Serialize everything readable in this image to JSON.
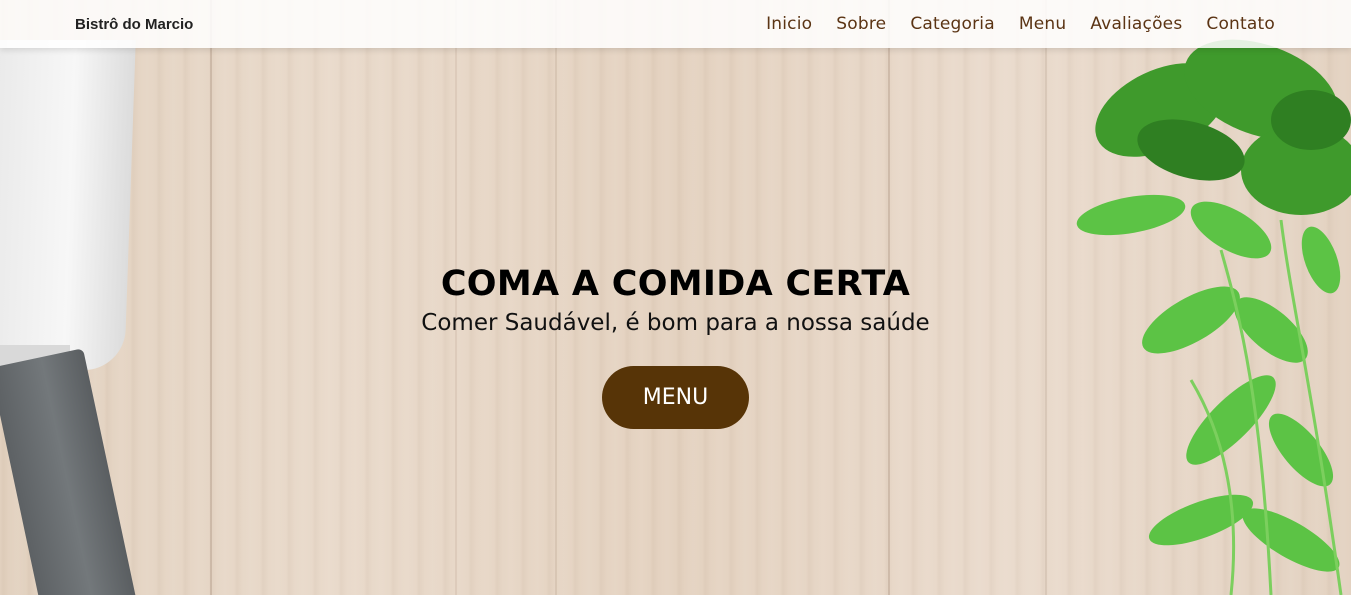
{
  "header": {
    "logo": "Bistrô do Marcio",
    "nav": [
      {
        "label": "Inicio"
      },
      {
        "label": "Sobre"
      },
      {
        "label": "Categoria"
      },
      {
        "label": "Menu"
      },
      {
        "label": "Avaliações"
      },
      {
        "label": "Contato"
      }
    ]
  },
  "hero": {
    "title": "COMA A COMIDA CERTA",
    "subtitle": "Comer Saudável, é bom para a nossa saúde",
    "button_label": "MENU"
  },
  "colors": {
    "accent": "#573407",
    "nav_text": "#5b3414",
    "header_bg": "#ffffff"
  }
}
